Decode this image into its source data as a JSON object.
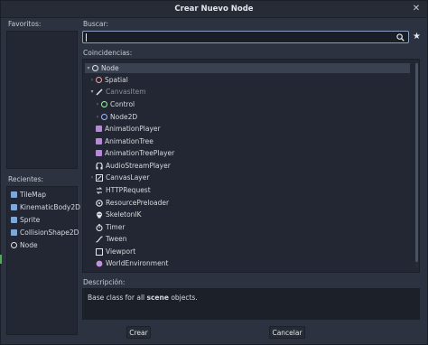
{
  "dialog": {
    "title": "Crear Nuevo Node",
    "close_glyph": "✕"
  },
  "favorites": {
    "label": "Favoritos:"
  },
  "recents": {
    "label": "Recientes:",
    "items": [
      {
        "label": "TileMap",
        "icon": "tilemap-icon",
        "color": "#7fa7d8"
      },
      {
        "label": "KinematicBody2D",
        "icon": "kinematicbody2d-icon",
        "color": "#7fa7d8"
      },
      {
        "label": "Sprite",
        "icon": "sprite-icon",
        "color": "#7fa7d8"
      },
      {
        "label": "CollisionShape2D",
        "icon": "collisionshape2d-icon",
        "color": "#7fa7d8"
      },
      {
        "label": "Node",
        "icon": "node-icon",
        "color": "#dfe3e8"
      }
    ]
  },
  "search": {
    "label": "Buscar:",
    "value": "",
    "placeholder": ""
  },
  "matches": {
    "label": "Coincidencias:",
    "rows": [
      {
        "label": "Node",
        "arrow": "▾",
        "icon": "node-icon"
      },
      {
        "label": "Spatial",
        "arrow": "›",
        "icon": "spatial-icon"
      },
      {
        "label": "CanvasItem",
        "arrow": "▾",
        "icon": "canvasitem-icon"
      },
      {
        "label": "Control",
        "arrow": "›",
        "icon": "control-icon"
      },
      {
        "label": "Node2D",
        "arrow": "›",
        "icon": "node2d-icon"
      },
      {
        "label": "AnimationPlayer",
        "arrow": "",
        "icon": "animationplayer-icon"
      },
      {
        "label": "AnimationTree",
        "arrow": "",
        "icon": "animationtree-icon"
      },
      {
        "label": "AnimationTreePlayer",
        "arrow": "",
        "icon": "animationtreeplayer-icon"
      },
      {
        "label": "AudioStreamPlayer",
        "arrow": "",
        "icon": "audiostreamplayer-icon"
      },
      {
        "label": "CanvasLayer",
        "arrow": "›",
        "icon": "canvaslayer-icon"
      },
      {
        "label": "HTTPRequest",
        "arrow": "",
        "icon": "httprequest-icon"
      },
      {
        "label": "ResourcePreloader",
        "arrow": "",
        "icon": "resourcepreloader-icon"
      },
      {
        "label": "SkeletonIK",
        "arrow": "",
        "icon": "skeletonik-icon"
      },
      {
        "label": "Timer",
        "arrow": "",
        "icon": "timer-icon"
      },
      {
        "label": "Tween",
        "arrow": "",
        "icon": "tween-icon"
      },
      {
        "label": "Viewport",
        "arrow": "",
        "icon": "viewport-icon"
      },
      {
        "label": "WorldEnvironment",
        "arrow": "",
        "icon": "worldenvironment-icon"
      }
    ]
  },
  "description": {
    "label": "Descripción:",
    "prefix": "Base class for all ",
    "bold": "scene",
    "suffix": " objects."
  },
  "buttons": {
    "create": "Crear",
    "cancel": "Cancelar"
  },
  "colors": {
    "panel": "#222733",
    "background": "#2c3240",
    "selection": "#3a4150",
    "accent": "#8a9fc0"
  }
}
